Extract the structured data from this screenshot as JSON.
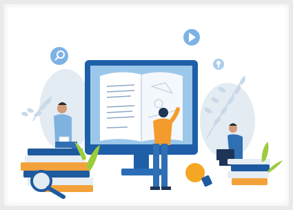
{
  "illustration": {
    "theme": "online learning",
    "icons": [
      "search-icon",
      "play-icon",
      "lightbulb-icon"
    ],
    "colors": {
      "background": "#ffffff",
      "leaf_light": "#dfe9f2",
      "leaf_mid": "#c6d8e8",
      "leaf_green": "#9ccc3a",
      "monitor_frame": "#1f5fa8",
      "monitor_screen": "#9bc7eb",
      "book_page": "#ffffff",
      "shirt_orange": "#f39b2c",
      "pants_blue": "#2f6fb3",
      "book_orange": "#f3a23b",
      "book_blue": "#1e5a9f",
      "book_light": "#e6edf4",
      "bulb_orange": "#f5a623",
      "icon_circle": "#7db3e4"
    }
  }
}
